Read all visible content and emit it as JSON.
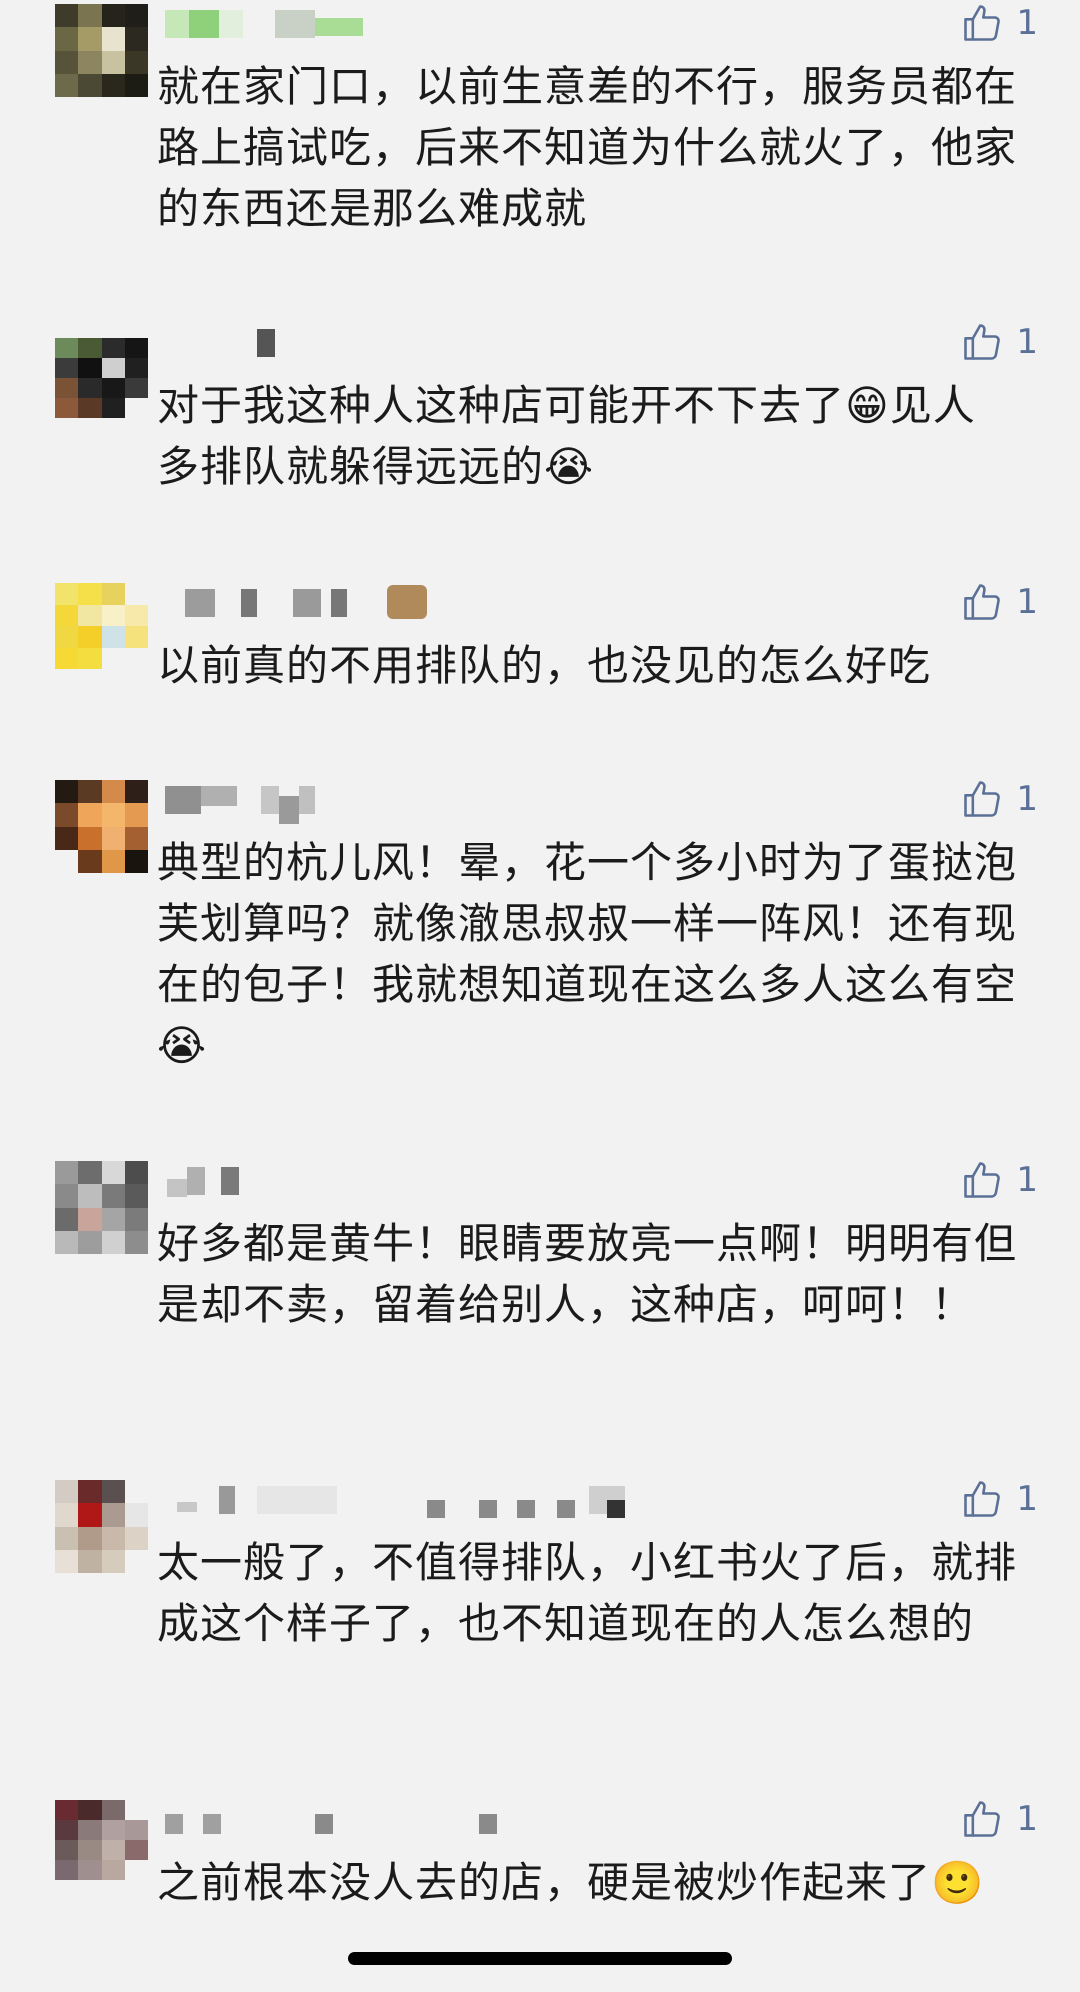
{
  "comments": [
    {
      "text": "就在家门口，以前生意差的不行，服务员都在路上搞试吃，后来不知道为什么就火了，他家的东西还是那么难成就",
      "likes": "1",
      "emoji_after": ""
    },
    {
      "text": "对于我这种人这种店可能开不下去了😁见人多排队就躲得远远的😭",
      "likes": "1",
      "emoji_after": ""
    },
    {
      "text": "以前真的不用排队的，也没见的怎么好吃",
      "likes": "1",
      "emoji_after": ""
    },
    {
      "text": "典型的杭儿风！晕，花一个多小时为了蛋挞泡芙划算吗？就像澈思叔叔一样一阵风！还有现在的包子！我就想知道现在这么多人这么有空😭",
      "likes": "1",
      "emoji_after": ""
    },
    {
      "text": "好多都是黄牛！眼睛要放亮一点啊！明明有但是却不卖，留着给别人，这种店，呵呵！！",
      "likes": "1",
      "emoji_after": ""
    },
    {
      "text": "太一般了，不值得排队，小红书火了后，就排成这个样子了，也不知道现在的人怎么想的",
      "likes": "1",
      "emoji_after": ""
    },
    {
      "text": "之前根本没人去的店，硬是被炒作起来了🙂",
      "likes": "1",
      "emoji_after": ""
    }
  ],
  "colors": {
    "background": "#f2f2f2",
    "text": "#1b1b1b",
    "like_icon": "#5b7096"
  },
  "icons": {
    "like": "thumbs-up-outline-icon",
    "avatar": "pixelated-avatar",
    "name": "pixelated-username"
  }
}
